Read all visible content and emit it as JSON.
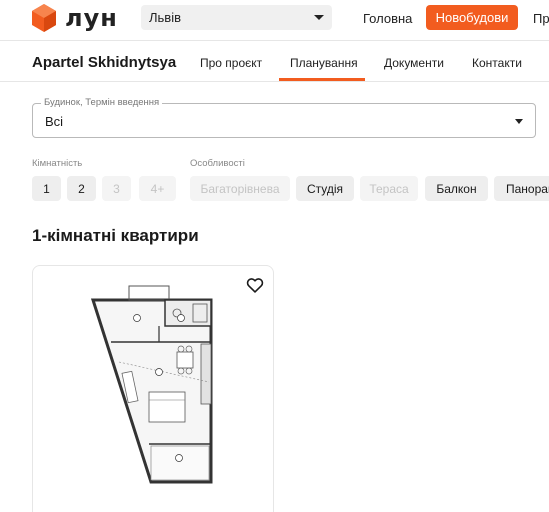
{
  "header": {
    "logo_text": "лун",
    "city": "Львів",
    "nav": {
      "home": "Головна",
      "new_buildings": "Новобудови",
      "more": "Пр"
    },
    "accent_color": "#f25c1f"
  },
  "project": {
    "title": "Apartel Skhidnytsya",
    "tabs": [
      {
        "label": "Про проєкт",
        "active": false
      },
      {
        "label": "Планування",
        "active": true
      },
      {
        "label": "Документи",
        "active": false
      },
      {
        "label": "Контакти",
        "active": false
      }
    ]
  },
  "building_select": {
    "legend": "Будинок, Термін введення",
    "value": "Всі"
  },
  "filters": {
    "rooms_label": "Кімнатність",
    "rooms": [
      {
        "label": "1",
        "enabled": true
      },
      {
        "label": "2",
        "enabled": true
      },
      {
        "label": "3",
        "enabled": false
      },
      {
        "label": "4+",
        "enabled": false
      }
    ],
    "features_label": "Особливості",
    "features": [
      {
        "label": "Багаторівнева",
        "enabled": false
      },
      {
        "label": "Студія",
        "enabled": true
      },
      {
        "label": "Тераса",
        "enabled": false
      },
      {
        "label": "Балкон",
        "enabled": true
      },
      {
        "label": "Панорам",
        "enabled": true
      }
    ]
  },
  "section": {
    "title": "1-кімнатні квартири"
  },
  "card": {
    "favorite_icon": "heart-outline-icon",
    "plan_image": "floor-plan"
  }
}
